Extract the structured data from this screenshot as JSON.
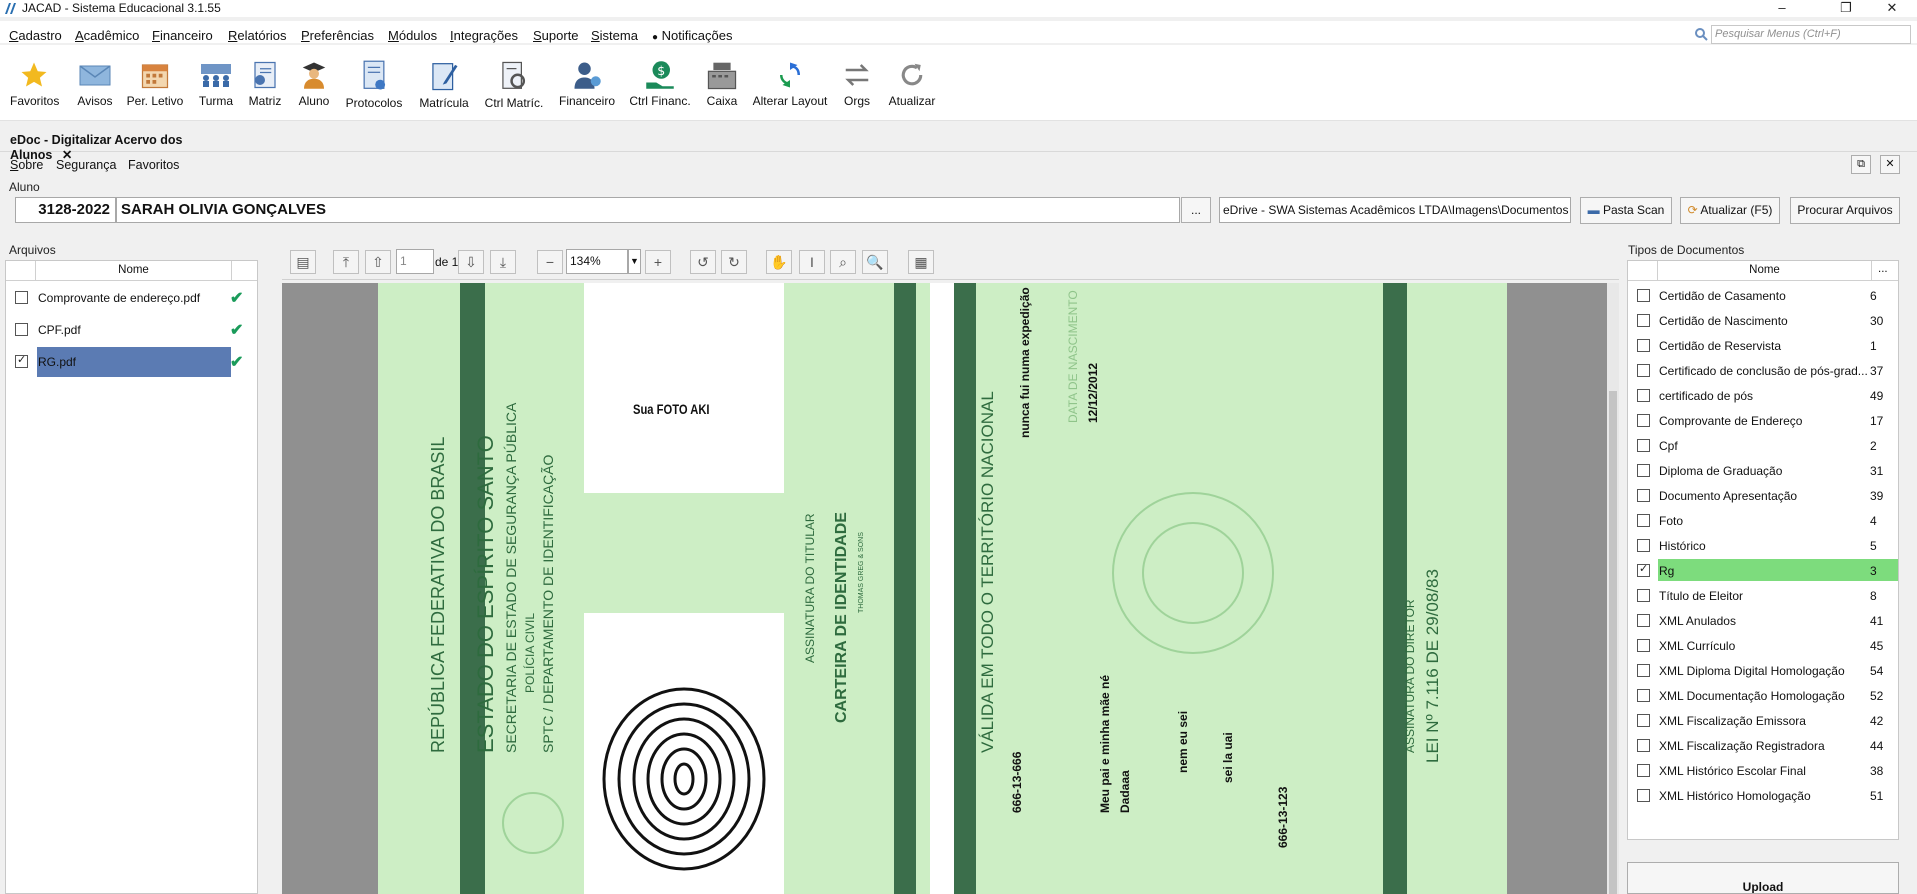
{
  "window": {
    "title": "JACAD - Sistema Educacional 3.1.55",
    "minimize": "–",
    "restore": "❐",
    "close": "✕"
  },
  "menu": [
    {
      "u": "C",
      "rest": "adastro"
    },
    {
      "u": "A",
      "rest": "cadêmico"
    },
    {
      "u": "F",
      "rest": "inanceiro"
    },
    {
      "u": "R",
      "rest": "elatórios"
    },
    {
      "u": "P",
      "rest": "referências"
    },
    {
      "u": "M",
      "rest": "ódulos"
    },
    {
      "u": "I",
      "rest": "ntegrações"
    },
    {
      "u": "S",
      "rest": "uporte"
    },
    {
      "u": "S",
      "rest": "istema"
    }
  ],
  "notificacoes": "Notificações",
  "search": {
    "placeholder": "Pesquisar Menus (Ctrl+F)"
  },
  "toolbar": {
    "favoritos": "Favoritos",
    "avisos": "Avisos",
    "per_letivo": "Per. Letivo",
    "turma": "Turma",
    "matriz": "Matriz",
    "aluno": "Aluno",
    "protocolos": "Protocolos",
    "matricula": "Matrícula",
    "ctrl_matric": "Ctrl Matríc.",
    "financeiro": "Financeiro",
    "ctrl_financ": "Ctrl Financ.",
    "caixa": "Caixa",
    "alterar_layout": "Alterar Layout",
    "orgs": "Orgs",
    "atualizar": "Atualizar"
  },
  "tab": {
    "label": "eDoc - Digitalizar Acervo dos Alunos",
    "close": "✕"
  },
  "submenu": {
    "sobre_u": "S",
    "sobre_rest": "obre",
    "seguranca": "Segurança",
    "favoritos": "Favoritos"
  },
  "aluno": {
    "group_label": "Aluno",
    "code": "3128-2022",
    "name": "SARAH OLIVIA GONÇALVES",
    "browse": "...",
    "path": "eDrive - SWA Sistemas Acadêmicos LTDA\\Imagens\\Documentos",
    "pasta_scan": "Pasta Scan",
    "atualizar": "Atualizar (F5)",
    "procurar": "Procurar Arquivos"
  },
  "arquivos": {
    "group_label": "Arquivos",
    "col_nome": "Nome",
    "files": [
      {
        "name": "Comprovante de endereço.pdf",
        "checked": false
      },
      {
        "name": "CPF.pdf",
        "checked": false
      },
      {
        "name": "RG.pdf",
        "checked": true
      }
    ]
  },
  "viewer": {
    "page": "1",
    "of": "de 1",
    "zoom": "134%"
  },
  "document": {
    "photo": "Sua FOTO AKI",
    "republica": "REPÚBLICA FEDERATIVA DO BRASIL",
    "estado": "ESTADO DO ESPÍRITO SANTO",
    "secretaria": "SECRETARIA DE ESTADO DE SEGURANÇA PÚBLICA",
    "policia": "POLÍCIA CIVIL",
    "sptc": "SPTC / DEPARTAMENTO DE IDENTIFICAÇÃO",
    "assinatura_titular": "ASSINATURA DO TITULAR",
    "carteira": "CARTEIRA DE IDENTIDADE",
    "valida": "VÁLIDA EM TODO O TERRITÓRIO NACIONAL",
    "expedicao": "nunca fui numa expedição",
    "data_nasc_label": "DATA DE NASCIMENTO",
    "data_nasc": "12/12/2012",
    "lei": "LEI Nº 7.116 DE 29/08/83",
    "assinatura_diretor": "ASSINATURA DO DIRETOR",
    "registro": "666-13-666",
    "filiacao": "Meu pai e minha mãe né",
    "filiacao2": "Dadaaa",
    "naturalidade": "nem eu sei",
    "origem": "sei la uai",
    "cpf": "666-13-123",
    "grafica": "THOMAS GREG & SONS"
  },
  "tipos": {
    "group_label": "Tipos de Documentos",
    "col_nome": "Nome",
    "col_more": "...",
    "items": [
      {
        "name": "Certidão de Casamento",
        "count": "6"
      },
      {
        "name": "Certidão de Nascimento",
        "count": "30"
      },
      {
        "name": "Certidão de Reservista",
        "count": "1"
      },
      {
        "name": "Certificado de conclusão de pós-grad...",
        "count": "37"
      },
      {
        "name": "certificado de pós",
        "count": "49"
      },
      {
        "name": "Comprovante de Endereço",
        "count": "17"
      },
      {
        "name": "Cpf",
        "count": "2"
      },
      {
        "name": "Diploma de Graduação",
        "count": "31"
      },
      {
        "name": "Documento Apresentação",
        "count": "39"
      },
      {
        "name": "Foto",
        "count": "4"
      },
      {
        "name": "Histórico",
        "count": "5"
      },
      {
        "name": "Rg",
        "count": "3",
        "selected": true
      },
      {
        "name": "Título de Eleitor",
        "count": "8"
      },
      {
        "name": "XML Anulados",
        "count": "41"
      },
      {
        "name": "XML Currículo",
        "count": "45"
      },
      {
        "name": "XML Diploma Digital Homologação",
        "count": "54"
      },
      {
        "name": "XML Documentação Homologação",
        "count": "52"
      },
      {
        "name": "XML Fiscalização Emissora",
        "count": "42"
      },
      {
        "name": "XML Fiscalização Registradora",
        "count": "44"
      },
      {
        "name": "XML Histórico Escolar Final",
        "count": "38"
      },
      {
        "name": "XML Histórico Homologação",
        "count": "51"
      }
    ],
    "upload": "Upload"
  },
  "colors": {
    "file_selected": "#5b7bb3",
    "tipo_selected": "#7ddc7d",
    "check_green": "#1a9b5a",
    "card_green": "#cdeec5",
    "stripe_green": "#3b6e4b"
  }
}
